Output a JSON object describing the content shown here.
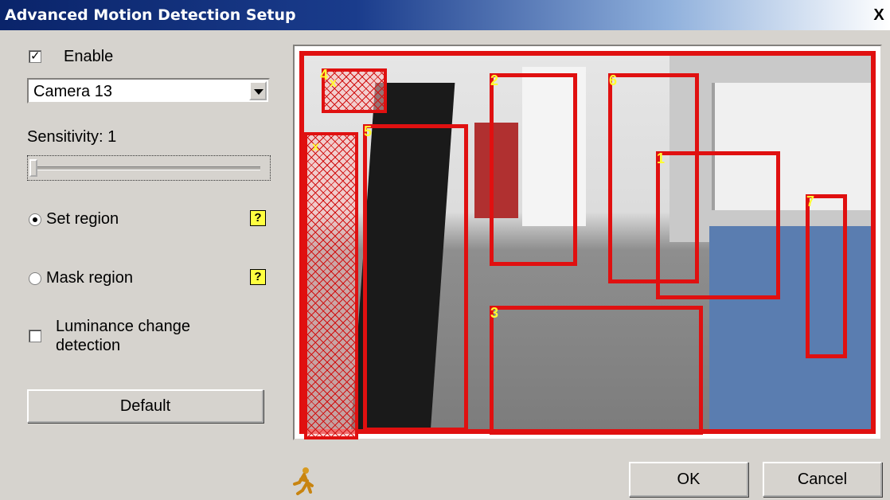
{
  "window": {
    "title": "Advanced Motion Detection Setup",
    "close_glyph": "X"
  },
  "enable": {
    "label": "Enable",
    "checked": true
  },
  "camera": {
    "selected": "Camera 13"
  },
  "sensitivity": {
    "label": "Sensitivity: 1",
    "value": 1
  },
  "modes": {
    "set_region": {
      "label": "Set region",
      "selected": true,
      "help": "?"
    },
    "mask_region": {
      "label": "Mask region",
      "selected": false,
      "help": "?"
    }
  },
  "luminance": {
    "label_line1": "Luminance change",
    "label_line2": "detection",
    "checked": false
  },
  "buttons": {
    "default": "Default",
    "ok": "OK",
    "cancel": "Cancel"
  },
  "regions": [
    {
      "num": "4"
    },
    {
      "num": "2"
    },
    {
      "num": "6"
    },
    {
      "num": "5"
    },
    {
      "num": "1"
    },
    {
      "num": "3"
    },
    {
      "num": "7"
    }
  ],
  "masks": [
    {
      "mark": "x"
    },
    {
      "mark": "x"
    }
  ],
  "colors": {
    "region": "#e01010",
    "label": "#ffff30",
    "title_bg": "#0a246a"
  }
}
